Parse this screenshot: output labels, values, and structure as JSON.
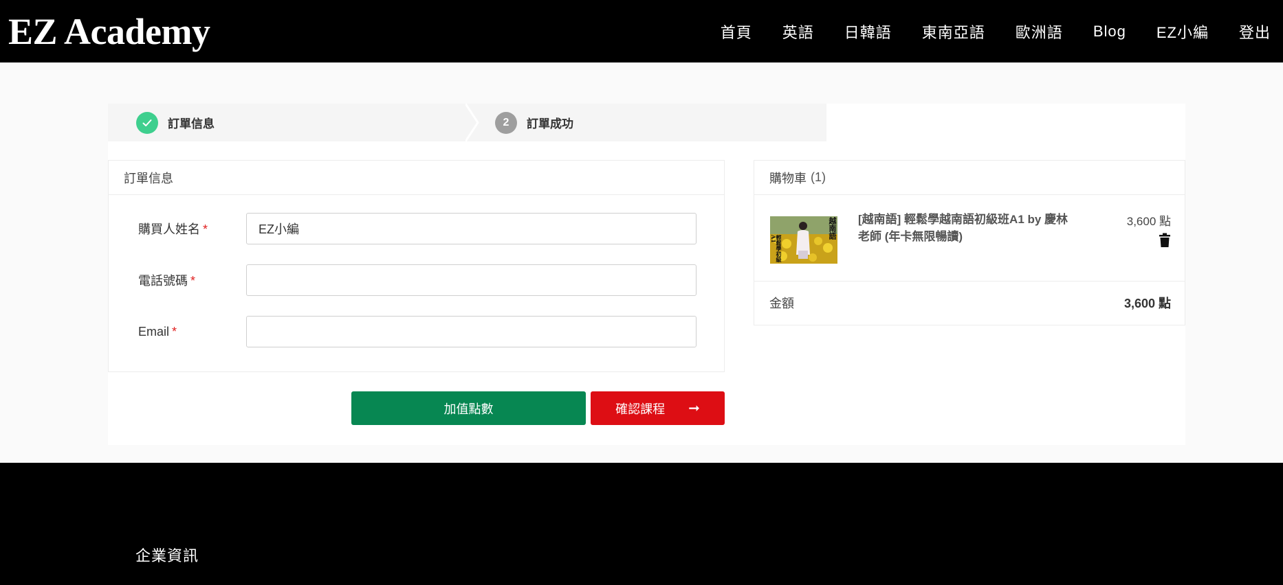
{
  "header": {
    "logo": "EZ Academy",
    "nav": [
      "首頁",
      "英語",
      "日韓語",
      "東南亞語",
      "歐洲語",
      "Blog",
      "EZ小編",
      "登出"
    ]
  },
  "steps": [
    {
      "label": "訂單信息",
      "state": "done"
    },
    {
      "number": "2",
      "label": "訂單成功",
      "state": "pending"
    }
  ],
  "order": {
    "title": "訂單信息",
    "fields": [
      {
        "label": "購買人姓名",
        "required": "*",
        "value": "EZ小編",
        "placeholder": ""
      },
      {
        "label": "電話號碼",
        "required": "*",
        "value": "",
        "placeholder": ""
      },
      {
        "label": "Email",
        "required": "*",
        "value": "",
        "placeholder": ""
      }
    ]
  },
  "buttons": {
    "topup": "加值點數",
    "confirm": "確認課程",
    "confirm_arrow": "➞"
  },
  "cart": {
    "title": "購物車",
    "count": "(1)",
    "items": [
      {
        "title": "[越南語] 輕鬆學越南語初級班A1 by 慶林老師 (年卡無限暢讀)",
        "price": "3,600 點",
        "thumb_text_right": "越南語",
        "thumb_text_left": "輕鬆學初級A1"
      }
    ],
    "total_label": "金額",
    "total_value": "3,600 點"
  },
  "footer": {
    "title": "企業資訊"
  },
  "colors": {
    "header_bg": "#000000",
    "step_done": "#3ecf8e",
    "step_pending": "#9e9e9e",
    "topup_button": "#078752",
    "confirm_button": "#dd0e14"
  }
}
